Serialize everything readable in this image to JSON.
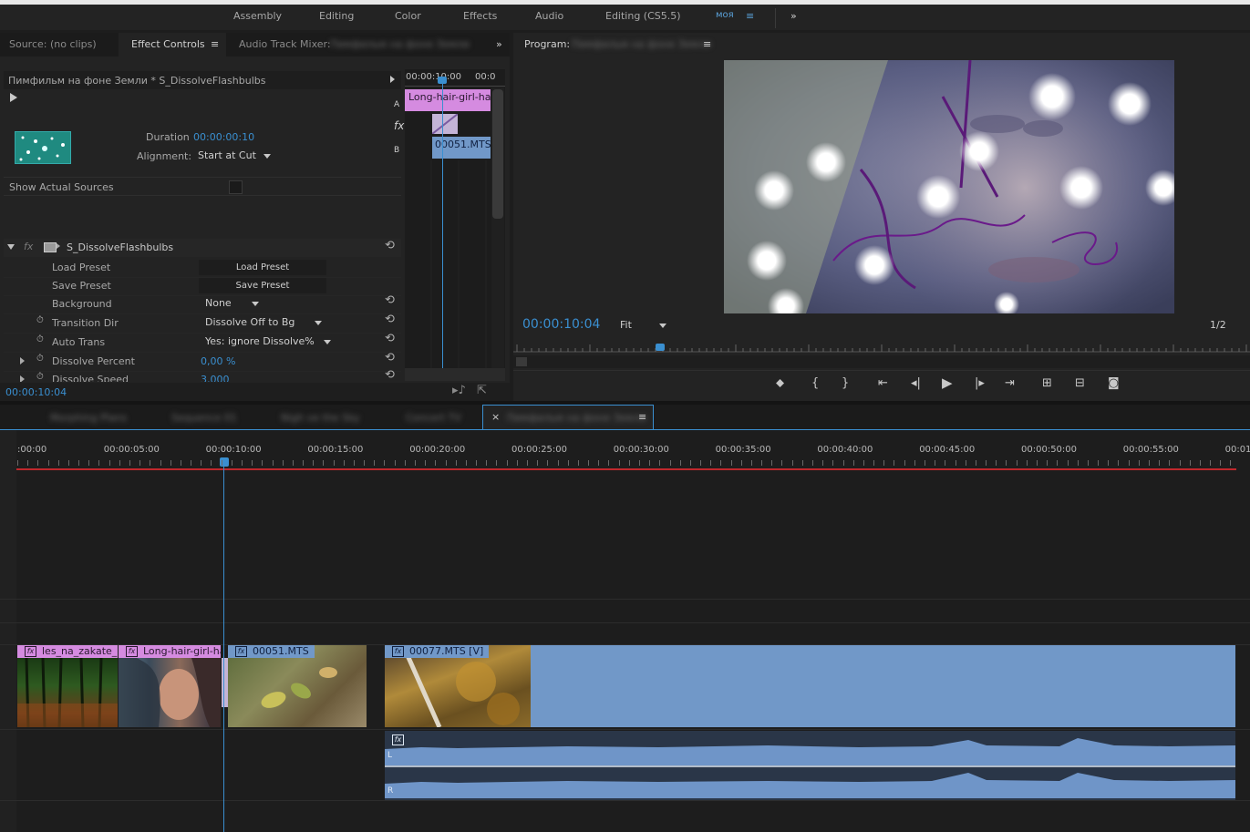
{
  "workspaces": [
    "Assembly",
    "Editing",
    "Color",
    "Effects",
    "Audio",
    "Editing (CS5.5)",
    "моя"
  ],
  "workspaces_active": "моя",
  "left_panel": {
    "tabs": {
      "source": "Source: (no clips)",
      "effect_controls": "Effect Controls",
      "audio_mixer": "Audio Track Mixer:",
      "audio_mixer_blurred": "Пимфильм на фоне Земли"
    },
    "header": "Пимфильм на фоне Земли * S_DissolveFlashbulbs",
    "duration_label": "Duration",
    "duration_value": "00:00:00:10",
    "alignment_label": "Alignment:",
    "alignment_value": "Start at Cut",
    "show_actual_sources": "Show Actual Sources",
    "effect_name": "S_DissolveFlashbulbs",
    "params": [
      {
        "label": "Load Preset",
        "value": "Load Preset"
      },
      {
        "label": "Save Preset",
        "value": "Save Preset"
      },
      {
        "label": "Background",
        "value": "None"
      },
      {
        "label": "Transition Dir",
        "value": "Dissolve Off to Bg"
      },
      {
        "label": "Auto Trans",
        "value": "Yes: ignore Dissolve%"
      },
      {
        "label": "Dissolve Percent",
        "value": "0,00 %"
      },
      {
        "label": "Dissolve Speed",
        "value": "3,000"
      }
    ],
    "mini_timeline": {
      "time_a": "00:00:10:00",
      "time_b": "00:0",
      "track_a": "A",
      "track_b": "B",
      "clip_a": "Long-hair-girl-hat",
      "clip_b": "00051.MTS"
    },
    "timecode": "00:00:10:04"
  },
  "program": {
    "label": "Program:",
    "blurred_name": "Пимфильм на фоне Земли",
    "timecode": "00:00:10:04",
    "fit": "Fit",
    "resolution": "1/2"
  },
  "sequence_tabs": {
    "blurred": [
      "Morphing Plans",
      "Sequence 01",
      "Nigh ve the Sky",
      "Concert TV"
    ],
    "active": "Пимфильм на фоне Земли"
  },
  "ruler": [
    ":00:00",
    "00:00:05:00",
    "00:00:10:00",
    "00:00:15:00",
    "00:00:20:00",
    "00:00:25:00",
    "00:00:30:00",
    "00:00:35:00",
    "00:00:40:00",
    "00:00:45:00",
    "00:00:50:00",
    "00:00:55:00",
    "00:01:0"
  ],
  "clips": [
    {
      "name": "les_na_zakate_"
    },
    {
      "name": "Long-hair-girl-ha"
    },
    {
      "name": "00051.MTS"
    },
    {
      "name": "00077.MTS [V]"
    }
  ],
  "audio_channels": {
    "left": "L",
    "right": "R"
  },
  "colors": {
    "accent_blue": "#3a8fd0",
    "clip_video": "#d58be0",
    "clip_blue": "#7198c8",
    "audio_wave": "#6f95c8",
    "ruler_red": "#c0282c"
  }
}
